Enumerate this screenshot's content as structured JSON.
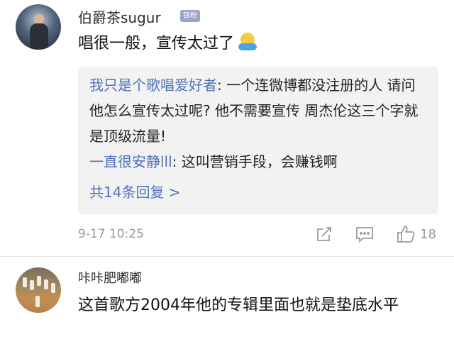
{
  "comments": [
    {
      "username": "伯爵茶sugur",
      "badge": "铁粉",
      "text": "唱很一般，宣传太过了",
      "emoji_icon": "hug-emoji-icon",
      "replies": [
        {
          "name": "我只是个歌唱爱好者",
          "text": ": 一个连微博都没注册的人 请问他怎么宣传太过呢? 他不需要宣传 周杰伦这三个字就是顶级流量!"
        },
        {
          "name": "一直很安静lll",
          "text": ": 这叫营销手段，会赚钱啊"
        }
      ],
      "more_replies": "共14条回复 >",
      "timestamp": "9-17 10:25",
      "like_count": "18",
      "icons": {
        "share": "share-icon",
        "comment": "comment-icon",
        "like": "thumbs-up-icon"
      }
    },
    {
      "username": "咔咔肥嘟嘟",
      "text": "这首歌方2004年他的专辑里面也就是垫底水平"
    }
  ],
  "colors": {
    "link": "#5072b8",
    "badge": "#9aa3c9",
    "meta": "#999999",
    "reply_bg": "#f2f2f2"
  }
}
